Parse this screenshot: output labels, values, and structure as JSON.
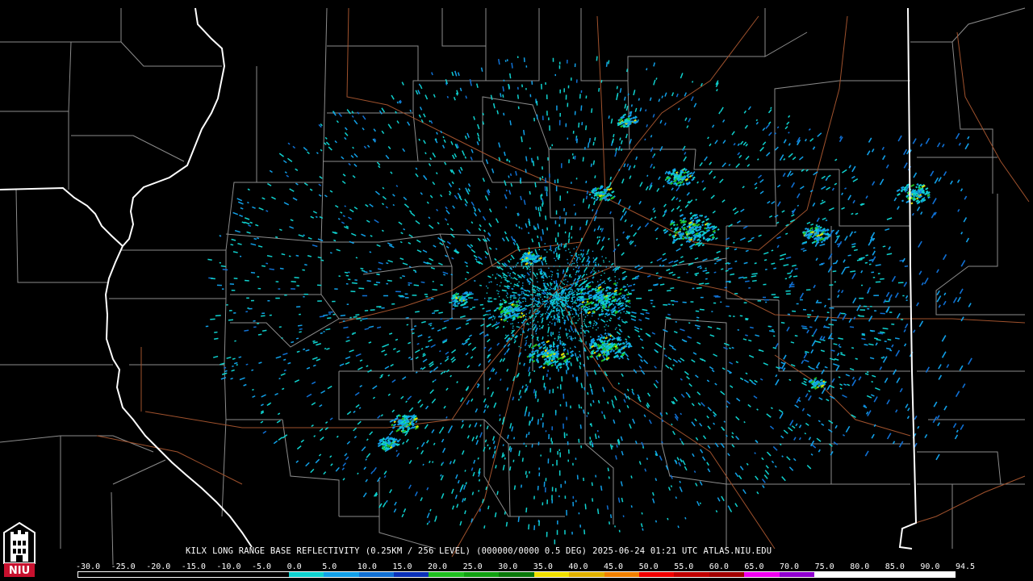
{
  "product": {
    "station": "KILX",
    "title": "LONG RANGE BASE REFLECTIVITY",
    "resolution": "(0.25KM / 256 LEVEL)",
    "volume": "(000000/0000 0.5 DEG)",
    "timestamp": "2025-06-24 01:21 UTC",
    "source": "ATLAS.NIU.EDU"
  },
  "logo": {
    "text": "NIU",
    "icon": "niu-logo-icon"
  },
  "colorbar": {
    "ticks": [
      "-30.0",
      "-25.0",
      "-20.0",
      "-15.0",
      "-10.0",
      "-5.0",
      "0.0",
      "5.0",
      "10.0",
      "15.0",
      "20.0",
      "25.0",
      "30.0",
      "35.0",
      "40.0",
      "45.0",
      "50.0",
      "55.0",
      "60.0",
      "65.0",
      "70.0",
      "75.0",
      "80.0",
      "85.0",
      "90.0",
      "94.5"
    ],
    "colors": [
      "#000000",
      "#000000",
      "#000000",
      "#000000",
      "#000000",
      "#000000",
      "#0fd2cf",
      "#11a0e8",
      "#1070d4",
      "#0a30b8",
      "#20c020",
      "#10a010",
      "#087808",
      "#f0e000",
      "#e0b000",
      "#f08000",
      "#f00000",
      "#c00000",
      "#a00000",
      "#f000f0",
      "#9000d0",
      "#ffffff",
      "#ffffff",
      "#ffffff",
      "#ffffff"
    ]
  },
  "map": {
    "state_border_color": "#ffffff",
    "county_border_color": "#8c8c8c",
    "highway_color": "#a0522d",
    "echo_colors": [
      "#0fd2cf",
      "#11a0e8",
      "#1070d4",
      "#20c020",
      "#e0e000"
    ]
  }
}
